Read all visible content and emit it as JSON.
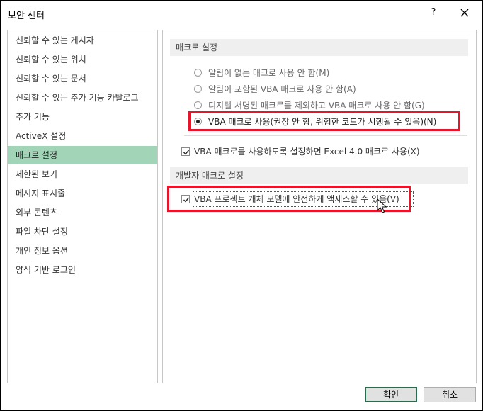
{
  "window": {
    "title": "보안 센터",
    "help_label": "?"
  },
  "sidebar": {
    "items": [
      {
        "label": "신뢰할 수 있는 게시자"
      },
      {
        "label": "신뢰할 수 있는 위치"
      },
      {
        "label": "신뢰할 수 있는 문서"
      },
      {
        "label": "신뢰할 수 있는 추가 기능 카탈로그"
      },
      {
        "label": "추가 기능"
      },
      {
        "label": "ActiveX 설정"
      },
      {
        "label": "매크로 설정",
        "selected": true
      },
      {
        "label": "제한된 보기"
      },
      {
        "label": "메시지 표시줄"
      },
      {
        "label": "외부 콘텐츠"
      },
      {
        "label": "파일 차단 설정"
      },
      {
        "label": "개인 정보 옵션"
      },
      {
        "label": "양식 기반 로그인"
      }
    ]
  },
  "macro_settings": {
    "header": "매크로 설정",
    "options": [
      {
        "label": "알림이 없는 매크로 사용 안 함(M)",
        "selected": false
      },
      {
        "label": "알림이 포함된 VBA 매크로 사용 안 함(A)",
        "selected": false
      },
      {
        "label": "디지털 서명된 매크로를 제외하고 VBA 매크로 사용 안 함(G)",
        "selected": false
      },
      {
        "label": "VBA 매크로 사용(권장 안 함, 위험한 코드가 시행될 수 있음)(N)",
        "selected": true
      }
    ],
    "excel4_checkbox": {
      "label": "VBA 매크로를 사용하도록 설정하면 Excel 4.0 매크로 사용(X)",
      "checked": true
    }
  },
  "developer_settings": {
    "header": "개발자 매크로 설정",
    "vba_trust_checkbox": {
      "label": "VBA 프로젝트 개체 모델에 안전하게 액세스할 수 있음(V)",
      "checked": true
    }
  },
  "footer": {
    "ok_label": "확인",
    "cancel_label": "취소"
  },
  "colors": {
    "selection": "#a2d5b8",
    "highlight": "#e8142a",
    "default_button_border": "#2b6b4b"
  }
}
